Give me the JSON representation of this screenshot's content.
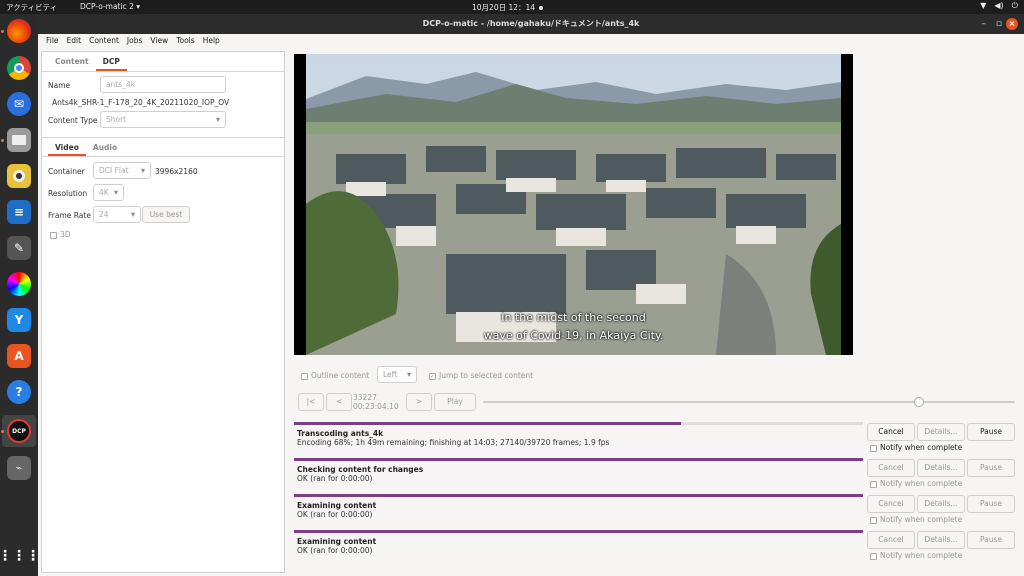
{
  "topbar": {
    "activities": "アクティビティ",
    "app_menu": "DCP-o-matic 2 ▾",
    "clock": "10月20日 12：14",
    "icons": [
      "network-icon",
      "volume-icon",
      "power-icon"
    ]
  },
  "dock": {
    "apps": [
      "firefox-icon",
      "chrome-icon",
      "thunderbird-icon",
      "files-icon",
      "rhythmbox-icon",
      "writer-icon",
      "gimp-icon",
      "color-picker-icon",
      "blender-icon",
      "software-center-icon",
      "help-icon",
      "dcp-o-matic-icon",
      "usb-drive-icon"
    ],
    "show_apps": "apps-grid-icon"
  },
  "window": {
    "title": "DCP-o-matic - /home/gahaku/ドキュメント/ants_4k"
  },
  "menu": [
    "File",
    "Edit",
    "Content",
    "Jobs",
    "View",
    "Tools",
    "Help"
  ],
  "left": {
    "tabs": [
      "Content",
      "DCP"
    ],
    "active_tab": "DCP",
    "name_label": "Name",
    "name_value": "ants_4k",
    "dcp_name": "Ants4k_SHR-1_F-178_20_4K_20211020_IOP_OV",
    "content_type_label": "Content Type",
    "content_type_value": "Short",
    "sub_tabs": [
      "Video",
      "Audio"
    ],
    "container_label": "Container",
    "container_value": "DCI Flat",
    "container_size": "3996x2160",
    "resolution_label": "Resolution",
    "resolution_value": "4K",
    "frame_rate_label": "Frame Rate",
    "frame_rate_value": "24",
    "use_best": "Use best",
    "three_d": "3D"
  },
  "viewer": {
    "subtitle_line1": "In the midst of the second",
    "subtitle_line2": "wave of Covid-19, in Akaiya City.",
    "outline_content": "Outline content",
    "eye": "Left",
    "jump_to_selected": "Jump to selected content",
    "btn_start": "|<",
    "btn_back": "<",
    "frame": "33227",
    "timecode": "00:23:04.10",
    "btn_fwd": ">",
    "btn_play": "Play",
    "position_fraction": 0.82
  },
  "jobs": [
    {
      "title": "Transcoding ants_4k",
      "status": "Encoding 68%; 1h 49m remaining; finishing at 14:03; 27140/39720 frames; 1.9 fps",
      "progress": 0.68,
      "cancel": "Cancel",
      "details": "Details...",
      "pause": "Pause",
      "notify": "Notify when complete",
      "active": true
    },
    {
      "title": "Checking content for changes",
      "status": "OK (ran for 0:00:00)",
      "progress": 1.0,
      "cancel": "Cancel",
      "details": "Details...",
      "pause": "Pause",
      "notify": "Notify when complete",
      "active": false
    },
    {
      "title": "Examining content",
      "status": "OK (ran for 0:00:00)",
      "progress": 1.0,
      "cancel": "Cancel",
      "details": "Details...",
      "pause": "Pause",
      "notify": "Notify when complete",
      "active": false
    },
    {
      "title": "Examining content",
      "status": "OK (ran for 0:00:00)",
      "progress": 1.0,
      "cancel": "Cancel",
      "details": "Details...",
      "pause": "Pause",
      "notify": "Notify when complete",
      "active": false
    }
  ],
  "colors": {
    "accent": "#e95420",
    "progress": "#7b3f86"
  }
}
